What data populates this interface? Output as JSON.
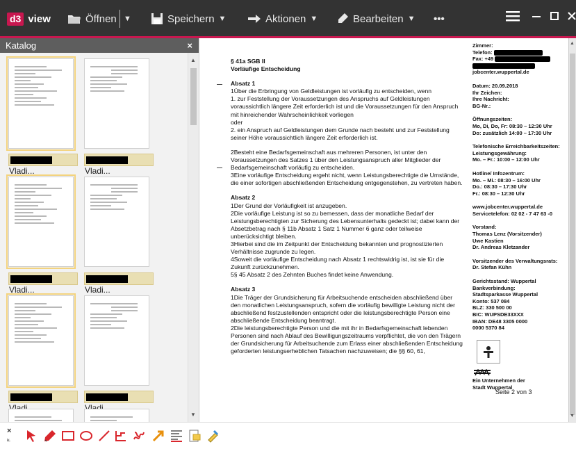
{
  "app": {
    "badge": "d3",
    "name": "view"
  },
  "toolbar": {
    "open_label": "Öffnen",
    "save_label": "Speichern",
    "actions_label": "Aktionen",
    "edit_label": "Bearbeiten",
    "more_label": "•••"
  },
  "catalog": {
    "title": "Katalog",
    "close_label": "×",
    "items": [
      {
        "label": "Vladi..."
      },
      {
        "label": "Vladi..."
      },
      {
        "label": "Vladi..."
      },
      {
        "label": "Vladi..."
      },
      {
        "label": "Vladi..."
      },
      {
        "label": "Vladi..."
      }
    ]
  },
  "document": {
    "heading1": "§ 41a SGB II",
    "heading2": "Vorläufige Entscheidung",
    "abs1_title": "Absatz 1",
    "abs1_p1": "1Über die Erbringung von Geldleistungen ist vorläufig zu entscheiden, wenn",
    "abs1_p2": "1. zur Feststellung der Voraussetzungen des Anspruchs auf Geldleistungen voraussichtlich längere Zeit erforderlich ist und die Voraussetzungen für den Anspruch mit hinreichender Wahrscheinlichkeit vorliegen",
    "abs1_p3": "oder",
    "abs1_p4": "2. ein Anspruch auf Geldleistungen dem Grunde nach besteht und zur Feststellung seiner Höhe voraussichtlich längere Zeit erforderlich ist.",
    "abs1_p5": "2Besteht eine Bedarfsgemeinschaft aus mehreren Personen, ist unter den Voraussetzungen des Satzes 1 über den Leistungsanspruch aller Mitglieder der Bedarfsgemeinschaft vorläufig zu entscheiden.",
    "abs1_p6": "3Eine vorläufige Entscheidung ergeht nicht, wenn Leistungsberechtigte die Umstände, die einer sofortigen abschließenden Entscheidung entgegenstehen, zu vertreten haben.",
    "abs2_title": "Absatz 2",
    "abs2_p1": "1Der Grund der Vorläufigkeit ist anzugeben.",
    "abs2_p2": "2Die vorläufige Leistung ist so zu bemessen, dass der monatliche Bedarf der Leistungsberechtigten zur Sicherung des Lebensunterhalts gedeckt ist; dabei kann der Absetzbetrag nach § 11b Absatz 1 Satz 1 Nummer 6 ganz oder teilweise unberücksichtigt bleiben.",
    "abs2_p3": "3Hierbei sind die im Zeitpunkt der Entscheidung bekannten und prognostizierten Verhältnisse zugrunde zu legen.",
    "abs2_p4": "4Soweit die vorläufige Entscheidung nach Absatz 1 rechtswidrig ist, ist sie für die Zukunft zurückzunehmen.",
    "abs2_p5": "5§ 45 Absatz 2 des Zehnten Buches findet keine Anwendung.",
    "abs3_title": "Absatz 3",
    "abs3_p1": "1Die Träger der Grundsicherung für Arbeitsuchende entscheiden abschließend über den monatlichen Leistungsanspruch, sofern die vorläufig bewilligte Leistung nicht der abschließend festzustellenden entspricht oder die leistungsberechtigte Person eine abschließende Entscheidung beantragt.",
    "abs3_p2": "2Die leistungsberechtigte Person und die mit ihr in Bedarfsgemeinschaft lebenden Personen sind nach Ablauf des Bewilligungszeitraums verpflichtet, die von den Trägern der Grundsicherung für Arbeitsuchende zum Erlass einer abschließenden Entscheidung geforderten leistungserheblichen Tatsachen nachzuweisen; die §§ 60, 61,",
    "page_number": "Seite 2 von 3"
  },
  "sidebar": {
    "zimmer": "Zimmer:",
    "telefon": "Telefon:",
    "fax": "Fax: +49",
    "email": "jobcenter.wuppertal.de",
    "datum": "Datum: 20.09.2018",
    "ihr_zeichen": "Ihr Zeichen:",
    "ihre_nachricht": "Ihre Nachricht:",
    "bg_nr": "BG-Nr.:",
    "oeffnungszeiten": "Öffnungszeiten:",
    "oz1": "Mo, Di, Do, Fr: 08:30 – 12:30 Uhr",
    "oz2": "Do: zusätzlich  14:00 – 17:30 Uhr",
    "tel_erreich": "Telefonische Erreichbarkeitszeiten:",
    "leistungsgew": "Leistungsgewährung:",
    "lg1": "Mo. – Fr.:        10:00 – 12:00 Uhr",
    "hotline": "Hotline/ Infozentrum:",
    "h1": "Mo. – Mi.:       08:30 – 16:00 Uhr",
    "h2": "Do.:                08:30 – 17:30 Uhr",
    "h3": "Fr.:                 08:30 – 12:30 Uhr",
    "web": "www.jobcenter.wuppertal.de",
    "service": "Servicetelefon: 02 02 - 7 47 63 -0",
    "vorstand": "Vorstand:",
    "v1": "Thomas Lenz (Vorsitzender)",
    "v2": "Uwe Kastien",
    "v3": "Dr. Andreas Kletzander",
    "vr": "Vorsitzender des Verwaltungsrats:",
    "vr1": "Dr. Stefan Kühn",
    "gs": "Gerichtsstand: Wuppertal",
    "bank": "Bankverbindung:",
    "sparkasse": "Stadtsparkasse Wuppertal",
    "konto": "Konto:    537 084",
    "blz": "BLZ:       330 500 00",
    "bic": "BIC:        WUPSDE33XXX",
    "iban": "IBAN:     DE48 3305 0000",
    "iban2": "              0000 5370 84",
    "unternehmen": "Ein Unternehmen der",
    "stadt": "Stadt Wuppertal"
  },
  "colors": {
    "accent": "#c8174f",
    "toolbar_bg": "#333333",
    "label_bg": "#e9dfb3"
  },
  "annotation_tools": [
    "select-arrow-icon",
    "pen-icon",
    "rectangle-icon",
    "ellipse-icon",
    "line-icon",
    "polyline-icon",
    "freehand-icon",
    "arrow-icon",
    "text-icon",
    "note-icon",
    "stamp-icon"
  ]
}
